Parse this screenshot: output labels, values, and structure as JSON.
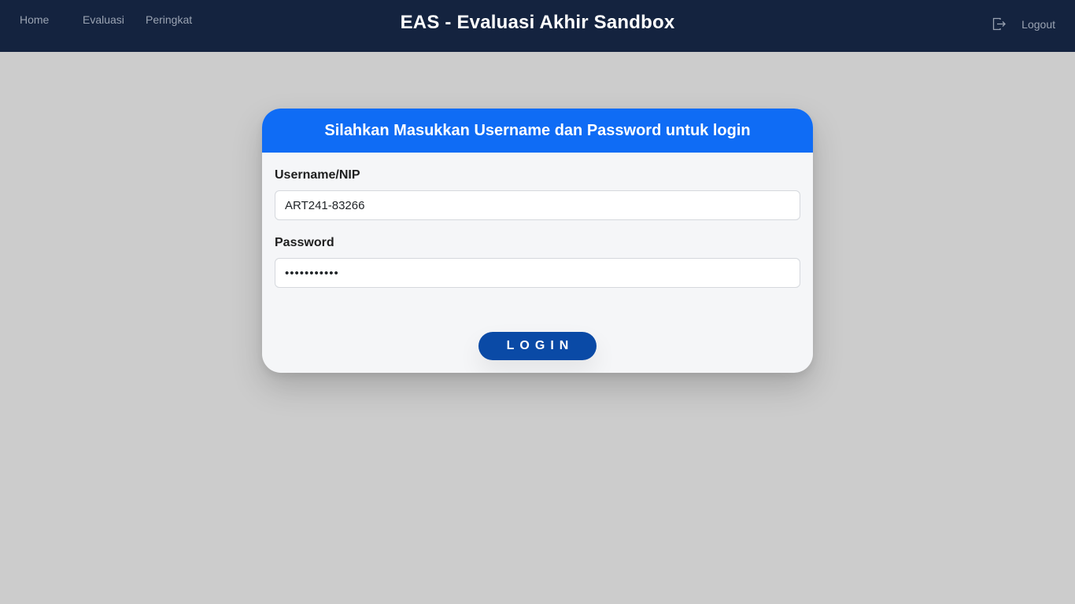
{
  "nav": {
    "home": "Home",
    "evaluasi": "Evaluasi",
    "peringkat": "Peringkat"
  },
  "header": {
    "title": "EAS - Evaluasi Akhir Sandbox",
    "logout_label": "Logout",
    "logout_icon": "logout-icon"
  },
  "login": {
    "heading": "Silahkan Masukkan Username dan Password untuk login",
    "username_label": "Username/NIP",
    "username_value": "ART241-83266",
    "password_label": "Password",
    "password_value": "•••••••••••",
    "button_label": "LOGIN"
  },
  "colors": {
    "topbar": "#14233f",
    "page_background": "#cccccc",
    "card_header": "#0f6cf5",
    "login_button": "#0a4aa6"
  }
}
